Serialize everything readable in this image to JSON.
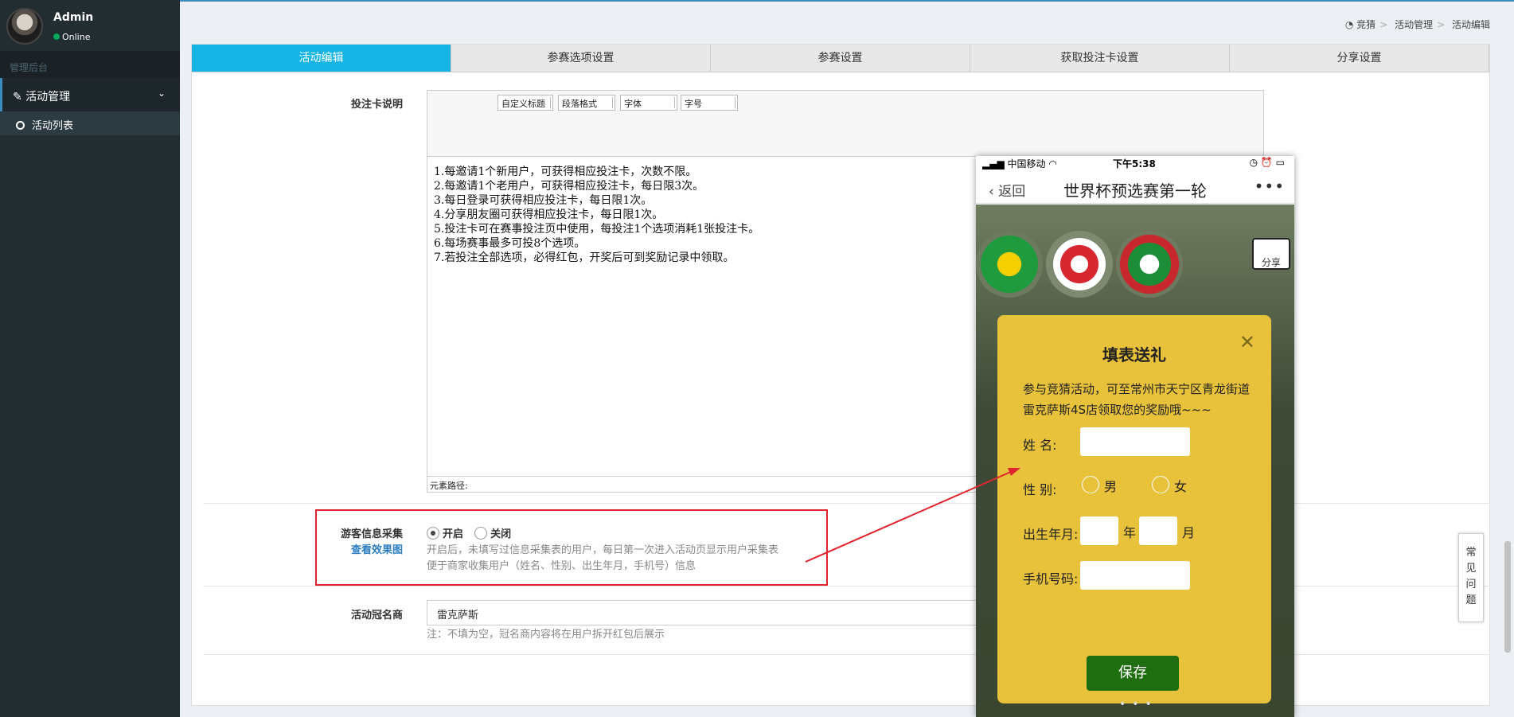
{
  "user": {
    "name": "Admin",
    "status": "Online"
  },
  "sidebar": {
    "header": "管理后台",
    "menu_parent": "活动管理",
    "menu_child": "活动列表"
  },
  "breadcrumb": [
    "竞猜",
    "活动管理",
    "活动编辑"
  ],
  "tabs": [
    "活动编辑",
    "参赛选项设置",
    "参赛设置",
    "获取投注卡设置",
    "分享设置"
  ],
  "form": {
    "card_desc_label": "投注卡说明",
    "toolbar": [
      "自定义标题",
      "段落格式",
      "字体",
      "字号"
    ],
    "editor_lines": [
      "1.每邀请1个新用户，可获得相应投注卡，次数不限。",
      "2.每邀请1个老用户，可获得相应投注卡，每日限3次。",
      "3.每日登录可获得相应投注卡，每日限1次。",
      "4.分享朋友圈可获得相应投注卡，每日限1次。",
      "5.投注卡可在赛事投注页中使用，每投注1个选项消耗1张投注卡。",
      "6.每场赛事最多可投8个选项。",
      "7.若投注全部选项，必得红包，开奖后可到奖励记录中领取。"
    ],
    "editor_path": "元素路径:",
    "guest_label": "游客信息采集",
    "guest_link": "查看效果图",
    "radio_on": "开启",
    "radio_off": "关闭",
    "guest_help_1": "开启后，未填写过信息采集表的用户，每日第一次进入活动页显示用户采集表",
    "guest_help_2": "便于商家收集用户（姓名、性别、出生年月，手机号）信息",
    "sponsor_label": "活动冠名商",
    "sponsor_value": "雷克萨斯",
    "sponsor_note": "注：不填为空，冠名商内容将在用户拆开红包后展示"
  },
  "phone": {
    "carrier": "中国移动",
    "time": "下午5:38",
    "back": "返回",
    "title": "世界杯预选赛第一轮",
    "share": "分享",
    "modal": {
      "title": "填表送礼",
      "desc": "参与竞猜活动，可至常州市天宁区青龙街道雷克萨斯4S店领取您的奖励哦~~~",
      "name_label": "姓 名:",
      "gender_label": "性 别:",
      "male": "男",
      "female": "女",
      "birth_label": "出生年月:",
      "year": "年",
      "month": "月",
      "phone_label": "手机号码:",
      "save": "保存"
    }
  },
  "faq": [
    "常",
    "见",
    "问",
    "题"
  ],
  "colors": {
    "accent": "#16b5e6",
    "sidebar": "#222d32",
    "highlight": "#e0252e",
    "modal": "#e8c23a",
    "save": "#1e6d0f"
  }
}
